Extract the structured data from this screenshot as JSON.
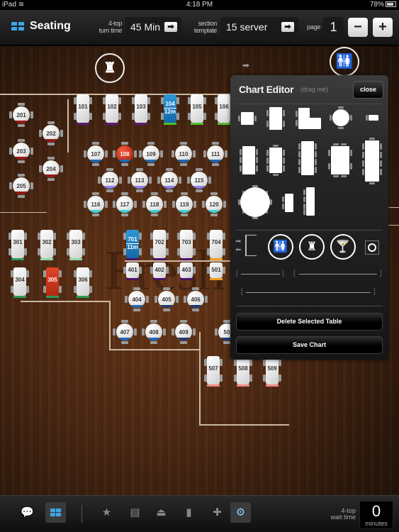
{
  "status_bar": {
    "device": "iPad",
    "time": "4:18 PM",
    "battery": "78%"
  },
  "toolbar": {
    "title": "Seating",
    "turn_time_label_1": "4-top",
    "turn_time_label_2": "turn time",
    "turn_time_value": "45 Min",
    "section_label_1": "section",
    "section_label_2": "template",
    "section_value": "15 server",
    "page_label": "page",
    "page_value": "1",
    "minus_label": "−",
    "plus_label": "+",
    "go_label": "➡"
  },
  "floor": {
    "brand_watermark": "Fresh",
    "status_colors": {
      "purple": "#5a1a7a",
      "green": "#4cc12a",
      "red": "#9a1414",
      "blue": "#1e68b8",
      "lavender": "#8a80e8",
      "cyan": "#40d0d8",
      "teal_green": "#2a9a5a",
      "mint": "#8ed8a8",
      "orange": "#f0a020",
      "dark_purple": "#4a1466",
      "pink": "#f08888",
      "navy": "#1a3a70"
    },
    "tables": [
      {
        "num": "101",
        "shape": "rect",
        "status": "purple"
      },
      {
        "num": "102",
        "shape": "rect",
        "status": "purple"
      },
      {
        "num": "103",
        "shape": "rect",
        "status": "purple"
      },
      {
        "num": "104",
        "shape": "rect",
        "status": "green",
        "selected": true,
        "timer": "12m"
      },
      {
        "num": "105",
        "shape": "rect",
        "status": "green"
      },
      {
        "num": "106",
        "shape": "rect",
        "status": "green"
      },
      {
        "num": "201",
        "shape": "round",
        "status": "red"
      },
      {
        "num": "202",
        "shape": "round",
        "status": "red"
      },
      {
        "num": "203",
        "shape": "round",
        "status": "red"
      },
      {
        "num": "204",
        "shape": "round",
        "status": "red"
      },
      {
        "num": "205",
        "shape": "round",
        "status": "red"
      },
      {
        "num": "107",
        "shape": "round",
        "status": "blue"
      },
      {
        "num": "108",
        "shape": "round",
        "status": "blue",
        "occupied": true
      },
      {
        "num": "109",
        "shape": "round",
        "status": "blue"
      },
      {
        "num": "110",
        "shape": "round",
        "status": "blue"
      },
      {
        "num": "111",
        "shape": "round",
        "status": "blue"
      },
      {
        "num": "112",
        "shape": "round",
        "status": "lavender"
      },
      {
        "num": "113",
        "shape": "round",
        "status": "lavender"
      },
      {
        "num": "114",
        "shape": "round",
        "status": "lavender"
      },
      {
        "num": "115",
        "shape": "round",
        "status": "lavender"
      },
      {
        "num": "116",
        "shape": "round",
        "status": "cyan"
      },
      {
        "num": "117",
        "shape": "round",
        "status": "cyan"
      },
      {
        "num": "118",
        "shape": "round",
        "status": "cyan"
      },
      {
        "num": "119",
        "shape": "round",
        "status": "cyan"
      },
      {
        "num": "120",
        "shape": "round",
        "status": "cyan"
      },
      {
        "num": "301",
        "shape": "rect",
        "status": "teal_green"
      },
      {
        "num": "302",
        "shape": "rect",
        "status": "mint"
      },
      {
        "num": "303",
        "shape": "rect",
        "status": "mint"
      },
      {
        "num": "304",
        "shape": "rect",
        "status": "teal_green"
      },
      {
        "num": "305",
        "shape": "rect",
        "status": "teal_green",
        "occupied": true
      },
      {
        "num": "306",
        "shape": "rect",
        "status": "teal_green"
      },
      {
        "num": "701",
        "shape": "rect",
        "status": "dark_purple",
        "selected": true,
        "timer": "11m"
      },
      {
        "num": "702",
        "shape": "rect",
        "status": "dark_purple"
      },
      {
        "num": "703",
        "shape": "rect",
        "status": "dark_purple"
      },
      {
        "num": "704",
        "shape": "rect",
        "status": "orange"
      },
      {
        "num": "401",
        "shape": "square",
        "status": "dark_purple"
      },
      {
        "num": "402",
        "shape": "square",
        "status": "dark_purple"
      },
      {
        "num": "403",
        "shape": "square",
        "status": "dark_purple"
      },
      {
        "num": "501",
        "shape": "square",
        "status": "orange"
      },
      {
        "num": "404",
        "shape": "round",
        "status": "blue"
      },
      {
        "num": "405",
        "shape": "round",
        "status": "navy"
      },
      {
        "num": "406",
        "shape": "round",
        "status": "navy"
      },
      {
        "num": "407",
        "shape": "round",
        "status": "blue"
      },
      {
        "num": "408",
        "shape": "round",
        "status": "blue"
      },
      {
        "num": "409",
        "shape": "round",
        "status": "navy"
      },
      {
        "num": "50",
        "shape": "round",
        "status": "navy"
      },
      {
        "num": "507",
        "shape": "rect",
        "status": "pink"
      },
      {
        "num": "508",
        "shape": "rect",
        "status": "pink"
      },
      {
        "num": "509",
        "shape": "rect",
        "status": "pink"
      }
    ],
    "icons": {
      "kitchen": "chef-hat-icon",
      "restroom": "restroom-icon"
    }
  },
  "chart_editor": {
    "title": "Chart Editor",
    "hint": "(drag me)",
    "close_label": "close",
    "delete_label": "Delete Selected Table",
    "save_label": "Save Chart"
  },
  "bottom_bar": {
    "items": [
      "chat",
      "seating",
      "favorites",
      "receipt",
      "ufo",
      "reports",
      "first-aid",
      "settings"
    ],
    "wait_label_1": "4-top",
    "wait_label_2": "wait time",
    "wait_value": "0",
    "wait_unit": "minutes"
  }
}
